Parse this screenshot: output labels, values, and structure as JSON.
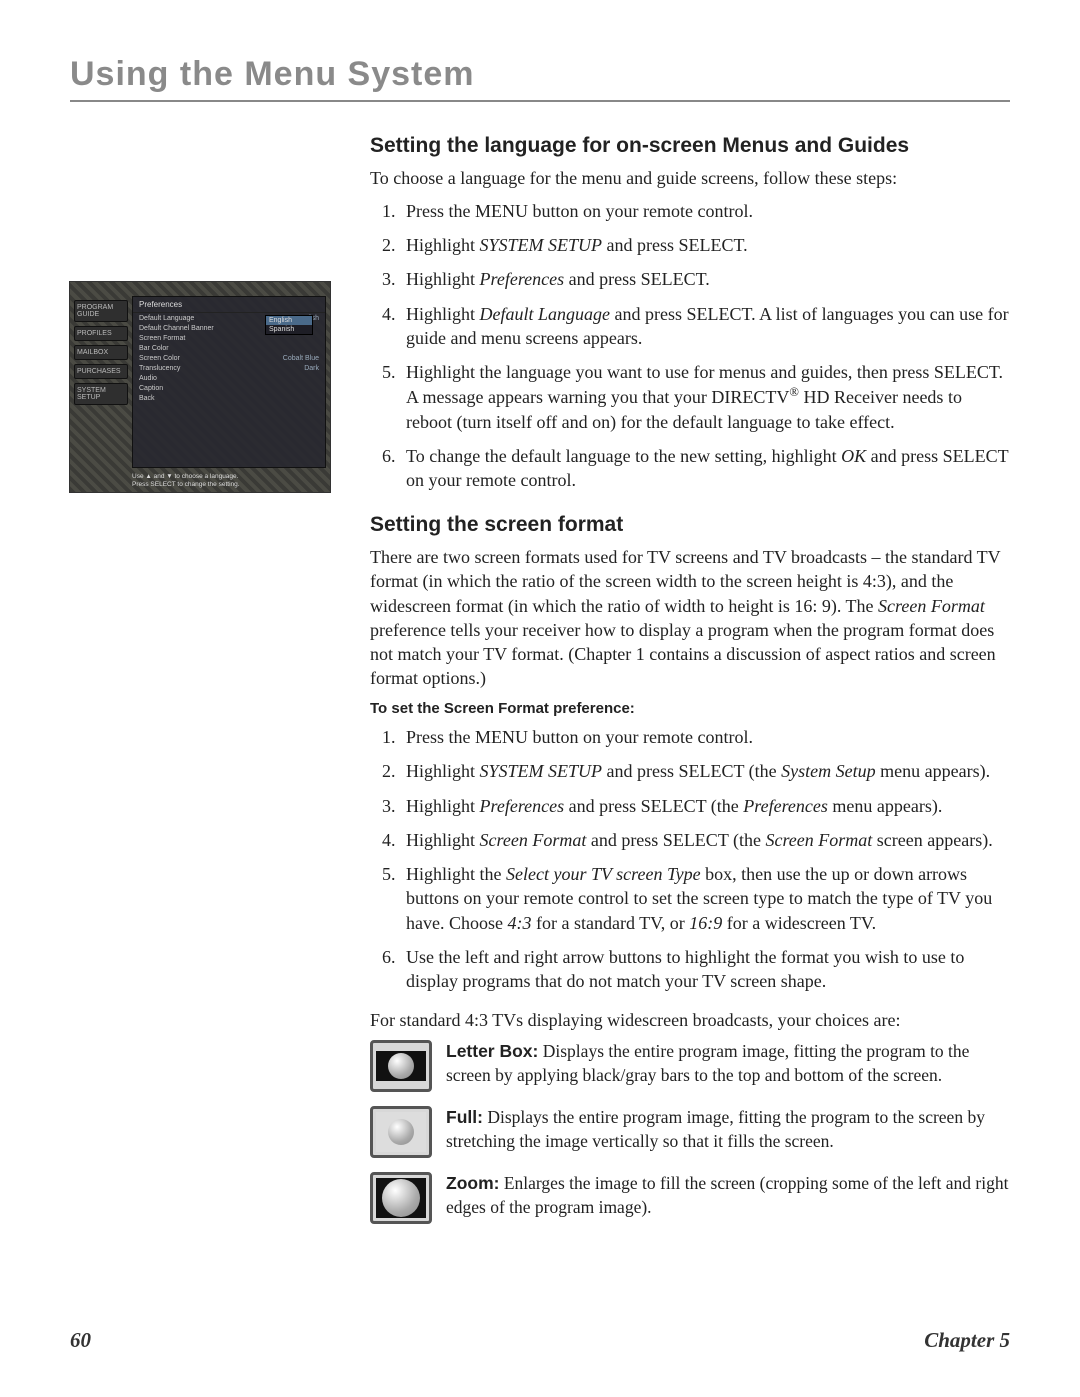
{
  "header": {
    "title": "Using the Menu System"
  },
  "section1": {
    "heading": "Setting the language for on-screen Menus and Guides",
    "intro": "To choose a language for the menu and guide screens, follow these steps:",
    "steps": [
      "Press the MENU button on your remote control.",
      "Highlight SYSTEM SETUP and press SELECT.",
      "Highlight Preferences and press SELECT.",
      "Highlight Default Language and press SELECT. A list of languages you can use for guide and menu screens appears.",
      "Highlight the language you want to use for menus and guides, then press SELECT. A message appears warning you that your DIRECTV® HD Receiver needs to reboot (turn itself off and on) for the default language to take effect.",
      "To change the default language to the new setting, highlight OK and press SELECT on your remote control."
    ]
  },
  "section2": {
    "heading": "Setting the screen format",
    "intro": "There are two screen formats used for TV screens and TV broadcasts – the standard TV format (in which the ratio of the screen width to the screen height is 4:3), and the widescreen format (in which the ratio of width to height is 16:9). The Screen Format preference tells your receiver how to display a program when the program format does not match your TV format. (Chapter 1 contains a discussion of aspect ratios and screen format options.)",
    "subhead": "To set the Screen Format preference:",
    "steps": [
      "Press the MENU button on your remote control.",
      "Highlight SYSTEM SETUP and press SELECT (the System Setup menu appears).",
      "Highlight Preferences and press SELECT (the Preferences menu appears).",
      "Highlight Screen Format and press SELECT (the Screen Format screen appears).",
      "Highlight the Select your TV screen Type box, then use the up or down arrows buttons on your remote control to set the screen type to match the type of TV you have. Choose 4:3 for a standard TV, or 16:9 for a widescreen TV.",
      "Use the left and right arrow buttons to highlight the format you wish to use to display programs that do not match your TV screen shape."
    ],
    "choices_intro": "For standard 4:3 TVs displaying widescreen broadcasts, your choices are:",
    "formats": [
      {
        "label": "Letter Box:",
        "desc": "Displays the entire program image, fitting the program to the screen by applying black/gray bars to the top and bottom of the screen."
      },
      {
        "label": "Full:",
        "desc": "Displays the entire program image, fitting the program to the screen by stretching the image vertically so that it fills the screen."
      },
      {
        "label": "Zoom:",
        "desc": "Enlarges the image to fill the screen (cropping some of the left and right edges of the program image)."
      }
    ]
  },
  "screenshot": {
    "panel_title": "Preferences",
    "sidebar": [
      "PROGRAM GUIDE",
      "PROFILES",
      "MAILBOX",
      "PURCHASES",
      "SYSTEM SETUP"
    ],
    "rows": [
      {
        "label": "Default Language",
        "value": "English"
      },
      {
        "label": "Default Channel Banner",
        "value": ""
      },
      {
        "label": "Screen Format",
        "value": ""
      },
      {
        "label": "Bar Color",
        "value": ""
      },
      {
        "label": "Screen Color",
        "value": "Cobalt Blue"
      },
      {
        "label": "Translucency",
        "value": "Dark"
      },
      {
        "label": "Audio",
        "value": ""
      },
      {
        "label": "Caption",
        "value": ""
      },
      {
        "label": "Back",
        "value": ""
      }
    ],
    "dropdown": [
      "English",
      "Spanish"
    ],
    "hint1": "Use ▲ and ▼ to choose a language.",
    "hint2": "Press SELECT to change the setting."
  },
  "footer": {
    "page": "60",
    "chapter": "Chapter 5"
  }
}
